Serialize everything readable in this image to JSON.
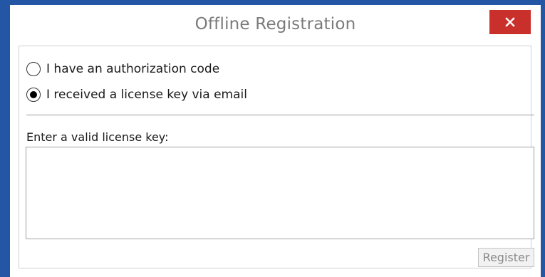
{
  "window": {
    "title": "Offline Registration",
    "accent_color": "#2456a6",
    "close_button_color": "#c9302c",
    "close_icon": "close-icon"
  },
  "options": [
    {
      "label": "I have an authorization code",
      "checked": false
    },
    {
      "label": "I received a license key via email",
      "checked": true
    }
  ],
  "license": {
    "label": "Enter a valid license key:",
    "value": ""
  },
  "actions": {
    "register_label": "Register",
    "register_enabled": false
  }
}
